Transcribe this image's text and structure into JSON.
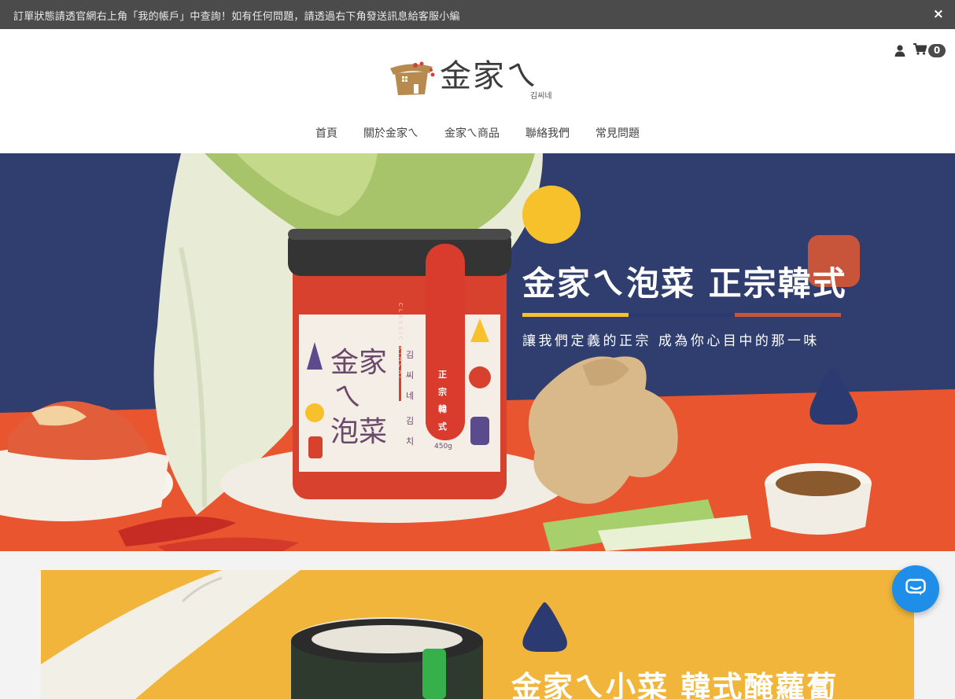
{
  "announcement": {
    "text": "訂單狀態請透官網右上角「我的帳戶」中查詢！如有任何問題，請透過右下角發送訊息給客服小編",
    "close_symbol": "×"
  },
  "header": {
    "logo_text": "金家ㄟ",
    "logo_sub": "김씨네",
    "cart_count": "0"
  },
  "nav": {
    "items": [
      "首頁",
      "關於金家ㄟ",
      "金家ㄟ商品",
      "聯絡我們",
      "常見問題"
    ]
  },
  "hero": {
    "title": "金家ㄟ泡菜 正宗韓式",
    "subtitle": "讓我們定義的正宗 成為你心目中的那一味",
    "jar": {
      "brand_line1": "金家",
      "brand_line2": "ㄟ",
      "brand_line3": "泡菜",
      "korean": [
        "김",
        "씨",
        "네",
        "김",
        "치"
      ],
      "red_label": [
        "正",
        "宗",
        "韓",
        "式"
      ],
      "classic": "CLASSIC KIMCHI",
      "weight": "450g"
    },
    "colors": {
      "navy": "#2f3e6e",
      "orange": "#e8552f",
      "yellow": "#f7c12c",
      "rust": "#c8553a"
    }
  },
  "banner2": {
    "title": "金家ㄟ小菜 韓式醃蘿蔔"
  },
  "icons": {
    "user": "user-icon",
    "cart": "cart-icon",
    "close": "close-icon",
    "chat": "chat-icon"
  }
}
